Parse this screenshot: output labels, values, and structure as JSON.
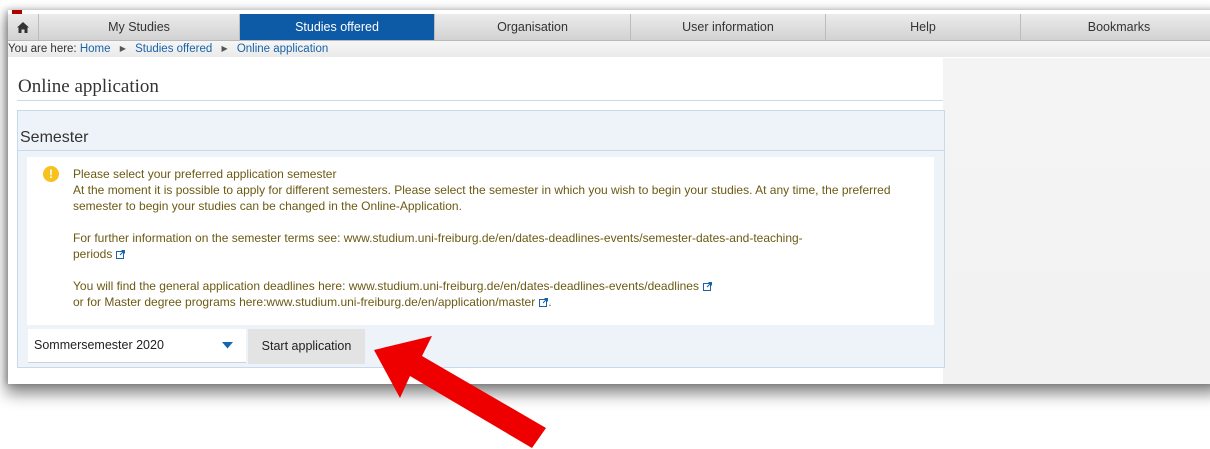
{
  "nav": {
    "tabs": [
      {
        "label": "My Studies",
        "active": false
      },
      {
        "label": "Studies offered",
        "active": true
      },
      {
        "label": "Organisation",
        "active": false
      },
      {
        "label": "User information",
        "active": false
      },
      {
        "label": "Help",
        "active": false
      },
      {
        "label": "Bookmarks",
        "active": false
      }
    ],
    "home_icon": "home-icon"
  },
  "breadcrumb": {
    "prefix": "You are here:",
    "items": [
      "Home",
      "Studies offered",
      "Online application"
    ]
  },
  "page": {
    "title": "Online application"
  },
  "semester": {
    "title": "Semester",
    "info": {
      "heading": "Please select your preferred application semester",
      "paragraph1": "At the moment it is possible to apply for different semesters. Please select the semester in which you wish to begin your studies. At any time, the preferred semester to begin your studies can be changed in the Online-Application.",
      "paragraph2_line1": "For further information on the semester terms see: www.studium.uni-freiburg.de/en/dates-deadlines-events/semester-dates-and-teaching-",
      "paragraph2_line2": "periods",
      "paragraph3_line1": "You will find the general application deadlines here: www.studium.uni-freiburg.de/en/dates-deadlines-events/deadlines",
      "paragraph3_line2": "or for Master degree programs here:www.studium.uni-freiburg.de/en/application/master",
      "paragraph3_end": "."
    },
    "select_value": "Sommersemester 2020",
    "start_button": "Start application"
  },
  "colors": {
    "active_tab": "#0d5aa7",
    "link": "#1a63a8",
    "info_text": "#6b5a14",
    "info_icon": "#f7c21c",
    "arrow": "#ee0000"
  }
}
